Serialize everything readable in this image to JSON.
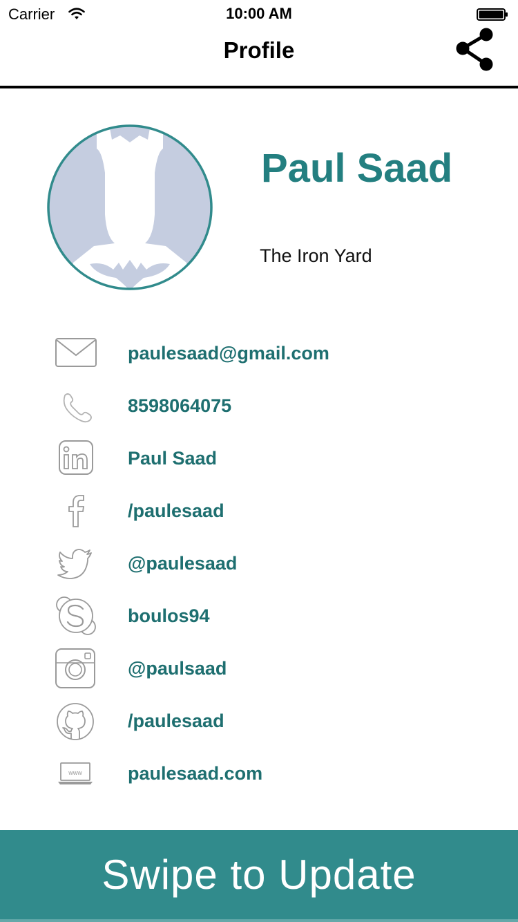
{
  "status_bar": {
    "carrier": "Carrier",
    "time": "10:00 AM",
    "wifi_icon": "wifi-icon",
    "battery_icon": "battery-icon"
  },
  "nav": {
    "title": "Profile",
    "share_icon": "share-icon"
  },
  "profile": {
    "name": "Paul Saad",
    "company": "The Iron Yard",
    "avatar_icon": "batman-silhouette-avatar"
  },
  "contacts": [
    {
      "icon": "email-icon",
      "value": "paulesaad@gmail.com"
    },
    {
      "icon": "phone-icon",
      "value": "8598064075"
    },
    {
      "icon": "linkedin-icon",
      "value": "Paul Saad"
    },
    {
      "icon": "facebook-icon",
      "value": "/paulesaad"
    },
    {
      "icon": "twitter-icon",
      "value": "@paulesaad"
    },
    {
      "icon": "skype-icon",
      "value": "boulos94"
    },
    {
      "icon": "instagram-icon",
      "value": "@paulsaad"
    },
    {
      "icon": "github-icon",
      "value": "/paulesaad"
    },
    {
      "icon": "website-icon",
      "value": "paulesaad.com"
    }
  ],
  "action": {
    "swipe_label": "Swipe to Update"
  },
  "colors": {
    "accent": "#318b8c",
    "name_text": "#237f80",
    "contact_text": "#1e6f70",
    "avatar_fill": "#c5cde0",
    "icon_gray": "#9a9a9a"
  }
}
